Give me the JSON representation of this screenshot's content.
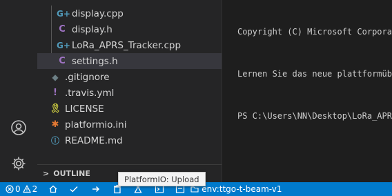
{
  "explorer": {
    "files": [
      {
        "name": "display.cpp",
        "icon": "cpp-file-icon",
        "glyph": "G+"
      },
      {
        "name": "display.h",
        "icon": "c-header-file-icon",
        "glyph": "C"
      },
      {
        "name": "LoRa_APRS_Tracker.cpp",
        "icon": "cpp-file-icon",
        "glyph": "G+"
      },
      {
        "name": "settings.h",
        "icon": "c-header-file-icon",
        "glyph": "C"
      },
      {
        "name": ".gitignore",
        "icon": "git-file-icon",
        "glyph": "◆"
      },
      {
        "name": ".travis.yml",
        "icon": "yaml-file-icon",
        "glyph": "!"
      },
      {
        "name": "LICENSE",
        "icon": "license-file-icon",
        "glyph": "🎗"
      },
      {
        "name": "platformio.ini",
        "icon": "ini-file-icon",
        "glyph": "✱"
      },
      {
        "name": "README.md",
        "icon": "info-file-icon",
        "glyph": "ⓘ"
      }
    ],
    "outline_label": "OUTLINE",
    "outline_chevron": ">"
  },
  "terminal": {
    "lines": [
      "Copyright (C) Microsoft Corpora",
      "Lernen Sie das neue plattformüb",
      "PS C:\\Users\\NN\\Desktop\\LoRa_APR"
    ]
  },
  "tooltip": {
    "text": "PlatformIO: Upload"
  },
  "statusbar": {
    "errors": "0",
    "warnings": "2",
    "env": "env:ttgo-t-beam-v1",
    "color": "#007acc"
  }
}
